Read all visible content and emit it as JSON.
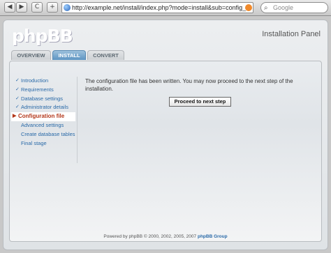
{
  "browser": {
    "url": "http://example.net/install/index.php?mode=install&sub=config_f",
    "search_placeholder": "Google",
    "buttons": {
      "back": "◀",
      "forward": "▶",
      "reload": "C",
      "add": "+"
    }
  },
  "header": {
    "logo": "phpBB",
    "panel_title": "Installation Panel"
  },
  "tabs": [
    {
      "label": "OVERVIEW",
      "active": false
    },
    {
      "label": "INSTALL",
      "active": true
    },
    {
      "label": "CONVERT",
      "active": false
    }
  ],
  "sidebar": {
    "items": [
      {
        "label": "Introduction",
        "state": "done"
      },
      {
        "label": "Requirements",
        "state": "done"
      },
      {
        "label": "Database settings",
        "state": "done"
      },
      {
        "label": "Administrator details",
        "state": "done"
      },
      {
        "label": "Configuration file",
        "state": "current"
      },
      {
        "label": "Advanced settings",
        "state": "pending"
      },
      {
        "label": "Create database tables",
        "state": "pending"
      },
      {
        "label": "Final stage",
        "state": "pending"
      }
    ]
  },
  "main": {
    "message": "The configuration file has been written. You may now proceed to the next step of the installation.",
    "proceed_label": "Proceed to next step"
  },
  "footer": {
    "text": "Powered by phpBB © 2000, 2002, 2005, 2007",
    "link": "phpBB Group"
  },
  "colors": {
    "accent": "#5d94c2",
    "link": "#2a6aa8",
    "current_step": "#b3371a"
  }
}
